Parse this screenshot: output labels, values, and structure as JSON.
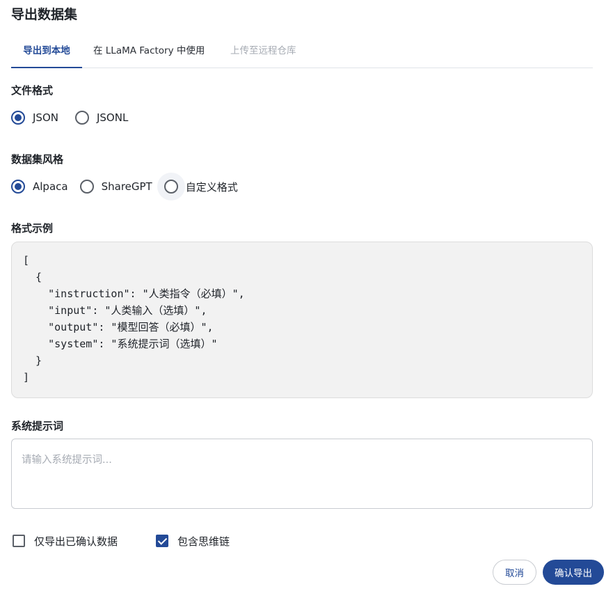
{
  "dialog": {
    "title": "导出数据集"
  },
  "tabs": [
    {
      "label": "导出到本地",
      "active": true
    },
    {
      "label": "在 LLaMA Factory 中使用",
      "active": false
    },
    {
      "label": "上传至远程仓库",
      "active": false,
      "disabled": true
    }
  ],
  "file_format": {
    "label": "文件格式",
    "options": [
      "JSON",
      "JSONL"
    ],
    "selected": "JSON"
  },
  "dataset_style": {
    "label": "数据集风格",
    "options": [
      "Alpaca",
      "ShareGPT",
      "自定义格式"
    ],
    "selected": "Alpaca"
  },
  "format_example": {
    "label": "格式示例",
    "code": "[\n  {\n    \"instruction\": \"人类指令（必填）\",\n    \"input\": \"人类输入（选填）\",\n    \"output\": \"模型回答（必填）\",\n    \"system\": \"系统提示词（选填）\"\n  }\n]"
  },
  "system_prompt": {
    "label": "系统提示词",
    "placeholder": "请输入系统提示词...",
    "value": ""
  },
  "options": {
    "confirmed_only": {
      "label": "仅导出已确认数据",
      "checked": false
    },
    "include_cot": {
      "label": "包含思维链",
      "checked": true
    }
  },
  "actions": {
    "cancel_label": "取消",
    "confirm_label": "确认导出"
  },
  "colors": {
    "accent": "#234a97",
    "code_bg": "#f2f2f2",
    "disabled_text": "#a6abb3"
  }
}
